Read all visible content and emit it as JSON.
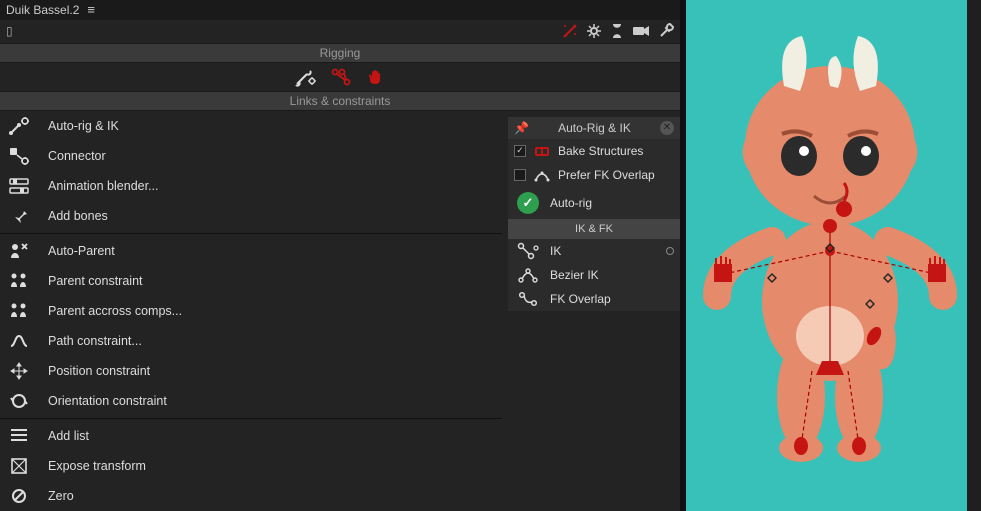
{
  "title": "Duik Bassel.2",
  "sections": {
    "rigging": "Rigging",
    "links": "Links & constraints"
  },
  "menu": [
    {
      "id": "autorigik",
      "label": "Auto-rig & IK"
    },
    {
      "id": "connector",
      "label": "Connector"
    },
    {
      "id": "animblender",
      "label": "Animation blender..."
    },
    {
      "id": "addbones",
      "label": "Add bones"
    },
    {
      "id": "autoparent",
      "label": "Auto-Parent"
    },
    {
      "id": "parentconstraint",
      "label": "Parent constraint"
    },
    {
      "id": "parentaccross",
      "label": "Parent accross comps..."
    },
    {
      "id": "pathconstraint",
      "label": "Path constraint..."
    },
    {
      "id": "positionconstraint",
      "label": "Position constraint"
    },
    {
      "id": "orientationconstraint",
      "label": "Orientation constraint"
    },
    {
      "id": "addlist",
      "label": "Add list"
    },
    {
      "id": "exposetransform",
      "label": "Expose transform"
    },
    {
      "id": "zero",
      "label": "Zero"
    }
  ],
  "subpanel": {
    "title": "Auto-Rig & IK",
    "bake": "Bake Structures",
    "prefer": "Prefer FK Overlap",
    "autorig": "Auto-rig",
    "ikfk": "IK & FK",
    "items": [
      {
        "id": "ik",
        "label": "IK"
      },
      {
        "id": "bezierik",
        "label": "Bezier IK"
      },
      {
        "id": "fkoverlap",
        "label": "FK Overlap"
      }
    ]
  },
  "colors": {
    "accent": "#c51414",
    "skin": "#e58a6a",
    "belly": "#f5cbb6",
    "horn": "#f1eee2"
  }
}
